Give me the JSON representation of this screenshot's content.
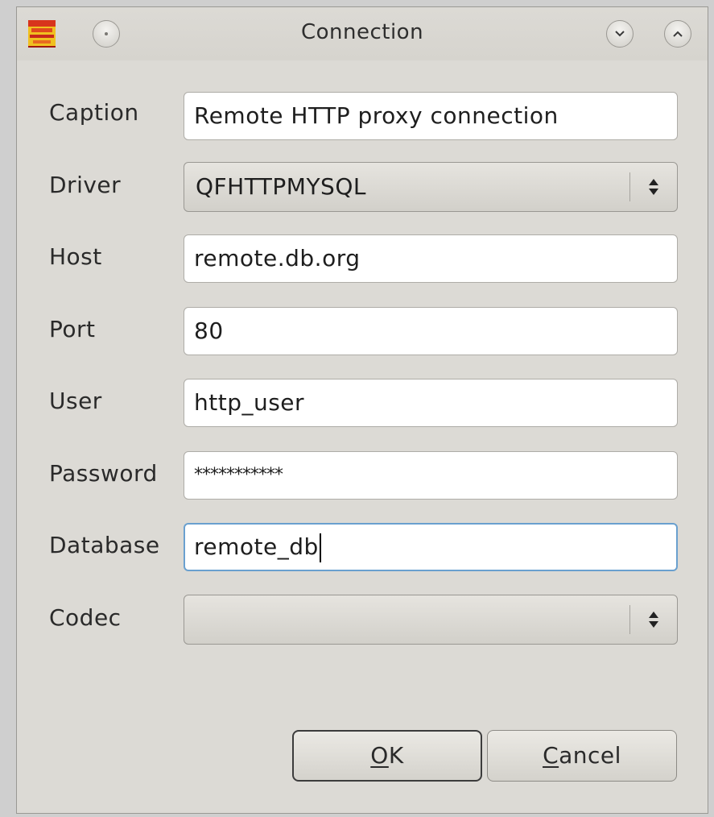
{
  "window": {
    "title": "Connection"
  },
  "icons": {
    "app": "app-icon",
    "menu": "window-menu-icon",
    "minimize": "minimize-chevron-down-icon",
    "maximize": "maximize-chevron-up-icon",
    "combo_arrows": "updown-arrows-icon"
  },
  "form": {
    "caption": {
      "label": "Caption",
      "value": "Remote HTTP proxy connection"
    },
    "driver": {
      "label": "Driver",
      "value": "QFHTTPMYSQL"
    },
    "host": {
      "label": "Host",
      "value": "remote.db.org"
    },
    "port": {
      "label": "Port",
      "value": "80"
    },
    "user": {
      "label": "User",
      "value": "http_user"
    },
    "password": {
      "label": "Password",
      "value": "***********"
    },
    "database": {
      "label": "Database",
      "value": "remote_db"
    },
    "codec": {
      "label": "Codec",
      "value": ""
    }
  },
  "buttons": {
    "ok": {
      "mnemonic": "O",
      "rest": "K"
    },
    "cancel": {
      "mnemonic": "C",
      "rest": "ancel"
    }
  },
  "colors": {
    "focus_border": "#6aa0cf",
    "window_bg": "#dcdad5"
  }
}
